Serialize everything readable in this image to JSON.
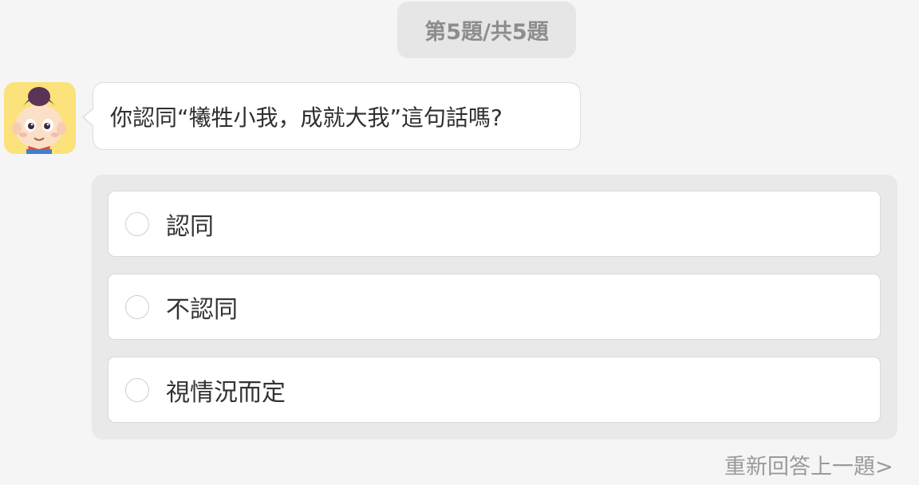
{
  "header": {
    "progress_text": "第5題/共5題"
  },
  "question": {
    "avatar_icon": "cartoon-character-icon",
    "text": "你認同“犧牲小我，成就大我”這句話嗎?"
  },
  "options": [
    {
      "label": "認同"
    },
    {
      "label": "不認同"
    },
    {
      "label": "視情況而定"
    }
  ],
  "footer": {
    "redo_label": "重新回答上一題>"
  },
  "colors": {
    "background": "#f5f5f5",
    "pill": "#e6e6e6",
    "panel": "#e9e9e9",
    "avatar_bg": "#fbe27a"
  }
}
